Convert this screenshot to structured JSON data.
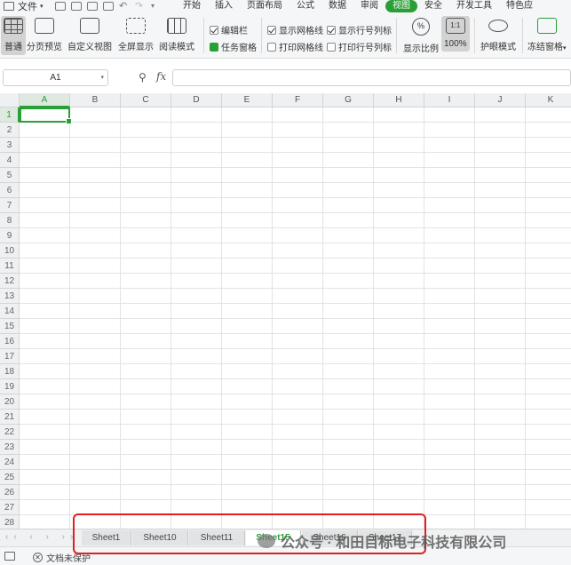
{
  "menubar": {
    "file_label": "文件",
    "tabs": [
      "开始",
      "插入",
      "页面布局",
      "公式",
      "数据",
      "审阅",
      "视图",
      "安全",
      "开发工具",
      "特色应"
    ],
    "active_tab": "视图"
  },
  "ribbon": {
    "normal": "普通",
    "page_break_preview": "分页预览",
    "custom_view": "自定义视图",
    "fullscreen": "全屏显示",
    "reading_mode": "阅读模式",
    "formula_bar": "编辑栏",
    "task_pane": "任务窗格",
    "show_gridlines": "显示网格线",
    "print_gridlines": "打印网格线",
    "show_headers": "显示行号列标",
    "print_headers": "打印行号列标",
    "zoom": "显示比例",
    "zoom_100": "100%",
    "zoom_100_icon_text": "1:1",
    "eye_protection": "护眼模式",
    "freeze_panes": "冻结窗格"
  },
  "formula": {
    "name_box": "A1",
    "fx_label": "fx",
    "value": ""
  },
  "grid": {
    "columns": [
      "A",
      "B",
      "C",
      "D",
      "E",
      "F",
      "G",
      "H",
      "I",
      "J",
      "K"
    ],
    "rows": [
      "1",
      "2",
      "3",
      "4",
      "5",
      "6",
      "7",
      "8",
      "9",
      "10",
      "11",
      "12",
      "13",
      "14",
      "15",
      "16",
      "17",
      "18",
      "19",
      "20",
      "21",
      "22",
      "23",
      "24",
      "25",
      "26",
      "27",
      "28"
    ],
    "active_cell": "A1"
  },
  "sheets": {
    "tabs": [
      "Sheet1",
      "Sheet10",
      "Sheet11",
      "Sheet15",
      "Sheet16",
      "Sheet17"
    ],
    "active": "Sheet15"
  },
  "status": {
    "protection": "文档未保护"
  },
  "watermark": {
    "text": "公众号 · 和田目标电子科技有限公司"
  },
  "colors": {
    "accent": "#29a035",
    "highlight": "#e02020"
  }
}
